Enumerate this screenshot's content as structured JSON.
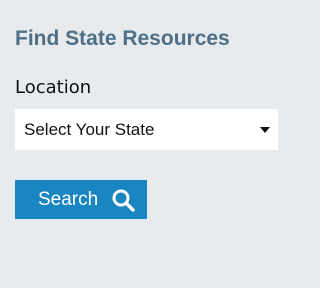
{
  "widget": {
    "title": "Find State Resources"
  },
  "location": {
    "label": "Location",
    "selected_value": "Select Your State"
  },
  "search": {
    "button_label": "Search",
    "icon": "search-icon"
  },
  "colors": {
    "background": "#e7ebee",
    "title": "#4e6f86",
    "button": "#1a86c1"
  }
}
